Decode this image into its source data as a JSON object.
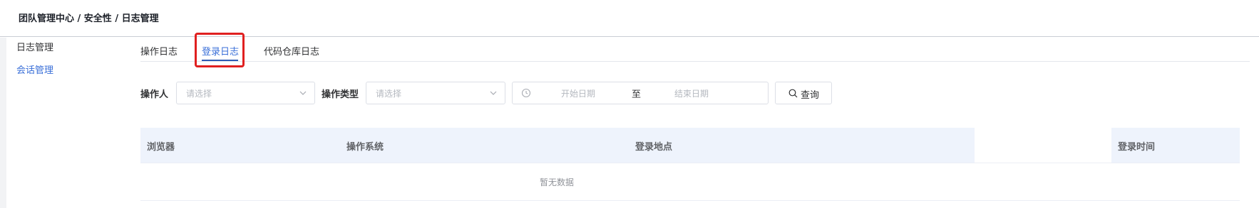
{
  "breadcrumb": "团队管理中心 / 安全性 / 日志管理",
  "sidebar": {
    "items": [
      {
        "label": "日志管理",
        "active": false
      },
      {
        "label": "会话管理",
        "active": true
      }
    ]
  },
  "tabs": [
    {
      "label": "操作日志",
      "active": false
    },
    {
      "label": "登录日志",
      "active": true
    },
    {
      "label": "代码仓库日志",
      "active": false
    }
  ],
  "filters": {
    "operator_label": "操作人",
    "operator_placeholder": "请选择",
    "op_type_label": "操作类型",
    "op_type_placeholder": "请选择",
    "start_date_placeholder": "开始日期",
    "range_separator": "至",
    "end_date_placeholder": "结束日期",
    "query_label": "查询"
  },
  "table": {
    "columns": [
      "浏览器",
      "操作系统",
      "登录地点",
      "登录时间"
    ],
    "empty_text": "暂无数据"
  },
  "colors": {
    "accent": "#3a6fd8",
    "highlight": "#e02020",
    "header_bg": "#eef3fc"
  },
  "icons": {
    "chevron": "chevron-down-icon",
    "clock": "clock-icon",
    "search": "search-icon"
  }
}
